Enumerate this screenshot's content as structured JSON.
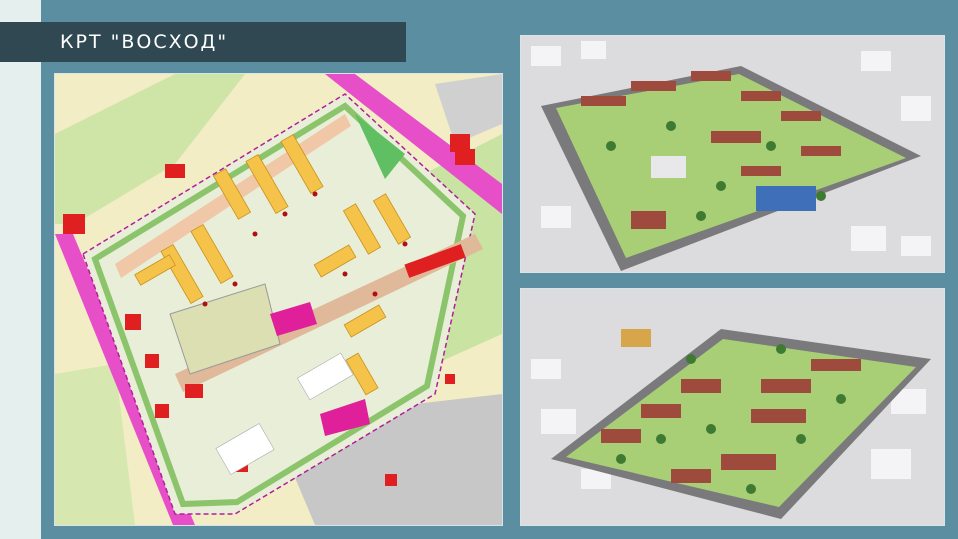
{
  "header": {
    "title": "КРТ \"ВОСХОД\""
  },
  "colors": {
    "background": "#5a8ea0",
    "side_strip": "#e4efee",
    "title_banner": "#2f4852",
    "title_text": "#ffffff",
    "residential": "#f5c34a",
    "existing_building": "#e02020",
    "public_building": "#e0209a",
    "road": "#e64fc8",
    "green_zone": "#b5df9a",
    "render_roof": "#9e4a3c"
  },
  "panels": [
    {
      "id": "master-plan",
      "kind": "site-plan"
    },
    {
      "id": "render-top",
      "kind": "3d-render-aerial"
    },
    {
      "id": "render-bottom",
      "kind": "3d-render-aerial"
    }
  ]
}
